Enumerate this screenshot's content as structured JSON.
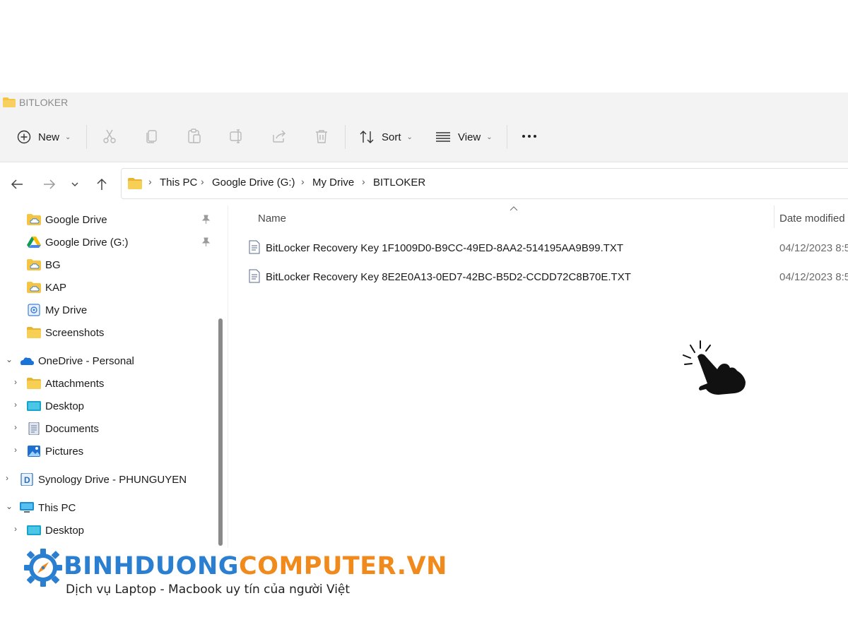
{
  "window": {
    "title": "BITLOKER"
  },
  "toolbar": {
    "new_label": "New",
    "sort_label": "Sort",
    "view_label": "View",
    "icons": [
      "cut-icon",
      "copy-icon",
      "paste-icon",
      "rename-icon",
      "share-icon",
      "delete-icon",
      "more-icon"
    ]
  },
  "breadcrumb": [
    "This PC",
    "Google Drive (G:)",
    "My Drive",
    "BITLOKER"
  ],
  "sidebar": {
    "items": [
      {
        "label": "Google Drive",
        "icon": "folder-cloud-icon",
        "pinned": true
      },
      {
        "label": "Google Drive (G:)",
        "icon": "google-drive-icon",
        "pinned": true
      },
      {
        "label": "BG",
        "icon": "folder-cloud-icon"
      },
      {
        "label": "KAP",
        "icon": "folder-cloud-icon"
      },
      {
        "label": "My Drive",
        "icon": "my-drive-icon"
      },
      {
        "label": "Screenshots",
        "icon": "folder-icon"
      },
      {
        "label": "OneDrive - Personal",
        "icon": "onedrive-icon",
        "expanded": true
      },
      {
        "label": "Attachments",
        "icon": "folder-icon"
      },
      {
        "label": "Desktop",
        "icon": "desktop-icon"
      },
      {
        "label": "Documents",
        "icon": "documents-icon"
      },
      {
        "label": "Pictures",
        "icon": "pictures-icon"
      },
      {
        "label": "Synology Drive - PHUNGUYEN",
        "icon": "synology-icon"
      },
      {
        "label": "This PC",
        "icon": "this-pc-icon",
        "expanded": true
      },
      {
        "label": "Desktop",
        "icon": "desktop-icon"
      }
    ]
  },
  "files": {
    "columns": {
      "name": "Name",
      "date": "Date modified"
    },
    "rows": [
      {
        "name": "BitLocker Recovery Key 1F1009D0-B9CC-49ED-8AA2-514195AA9B99.TXT",
        "date": "04/12/2023 8:5"
      },
      {
        "name": "BitLocker Recovery Key 8E2E0A13-0ED7-42BC-B5D2-CCDD72C8B70E.TXT",
        "date": "04/12/2023 8:5"
      }
    ]
  },
  "watermark": {
    "brand_part1": "BINHDUONG",
    "brand_part2": "COMPUTER.VN",
    "tagline": "Dịch vụ Laptop - Macbook uy tín của người Việt"
  },
  "colors": {
    "folder": "#f4c443",
    "accent": "#2a7fd0",
    "brand_orange": "#f08a1c"
  }
}
